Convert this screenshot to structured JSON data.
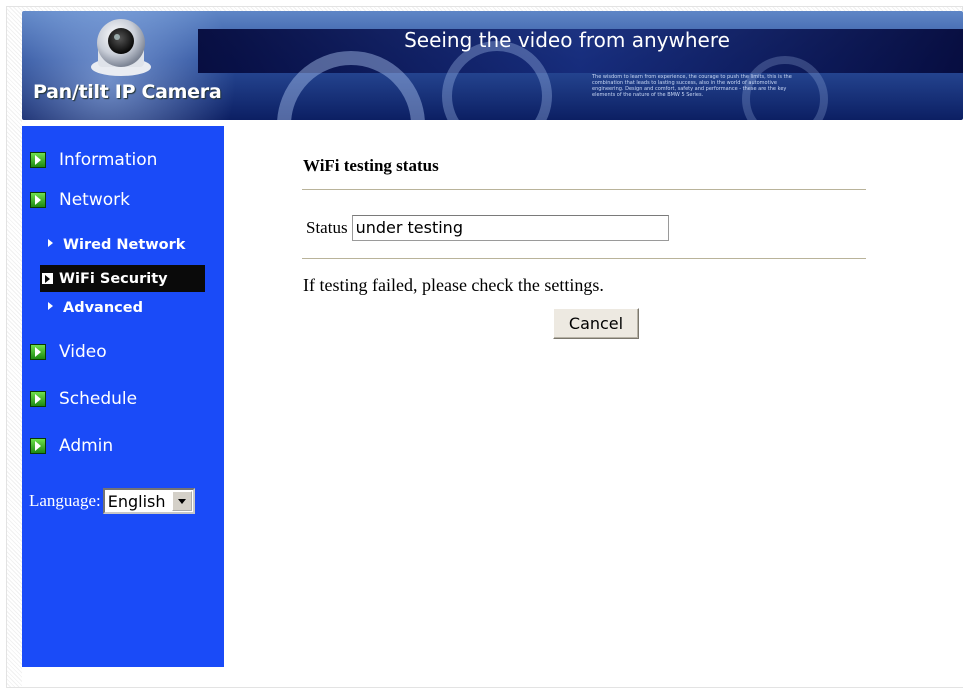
{
  "banner": {
    "title": "Seeing the video from anywhere",
    "brand": "Pan/tilt IP Camera",
    "small_text": "The wisdom to learn from experience, the courage to push the limits, this is the combination that leads to lasting success, also in the world of automotive engineering. Design and comfort, safety and performance - these are the key elements of the nature of the BMW 5 Series."
  },
  "sidebar": {
    "items": [
      {
        "label": "Information"
      },
      {
        "label": "Network"
      },
      {
        "label": "Video"
      },
      {
        "label": "Schedule"
      },
      {
        "label": "Admin"
      }
    ],
    "network_sub": [
      {
        "label": "Wired Network",
        "active": false
      },
      {
        "label": "WiFi Security",
        "active": true
      },
      {
        "label": "Advanced",
        "active": false
      }
    ],
    "language_label": "Language:",
    "language_value": "English"
  },
  "main": {
    "title": "WiFi testing status",
    "status_label": "Status",
    "status_value": "under testing",
    "note": "If testing failed, please check the settings.",
    "cancel_label": "Cancel"
  },
  "colors": {
    "sidebar_bg": "#1a4bf8",
    "active_item_bg": "#0a0a0a",
    "banner_dark": "#0c1f63"
  }
}
